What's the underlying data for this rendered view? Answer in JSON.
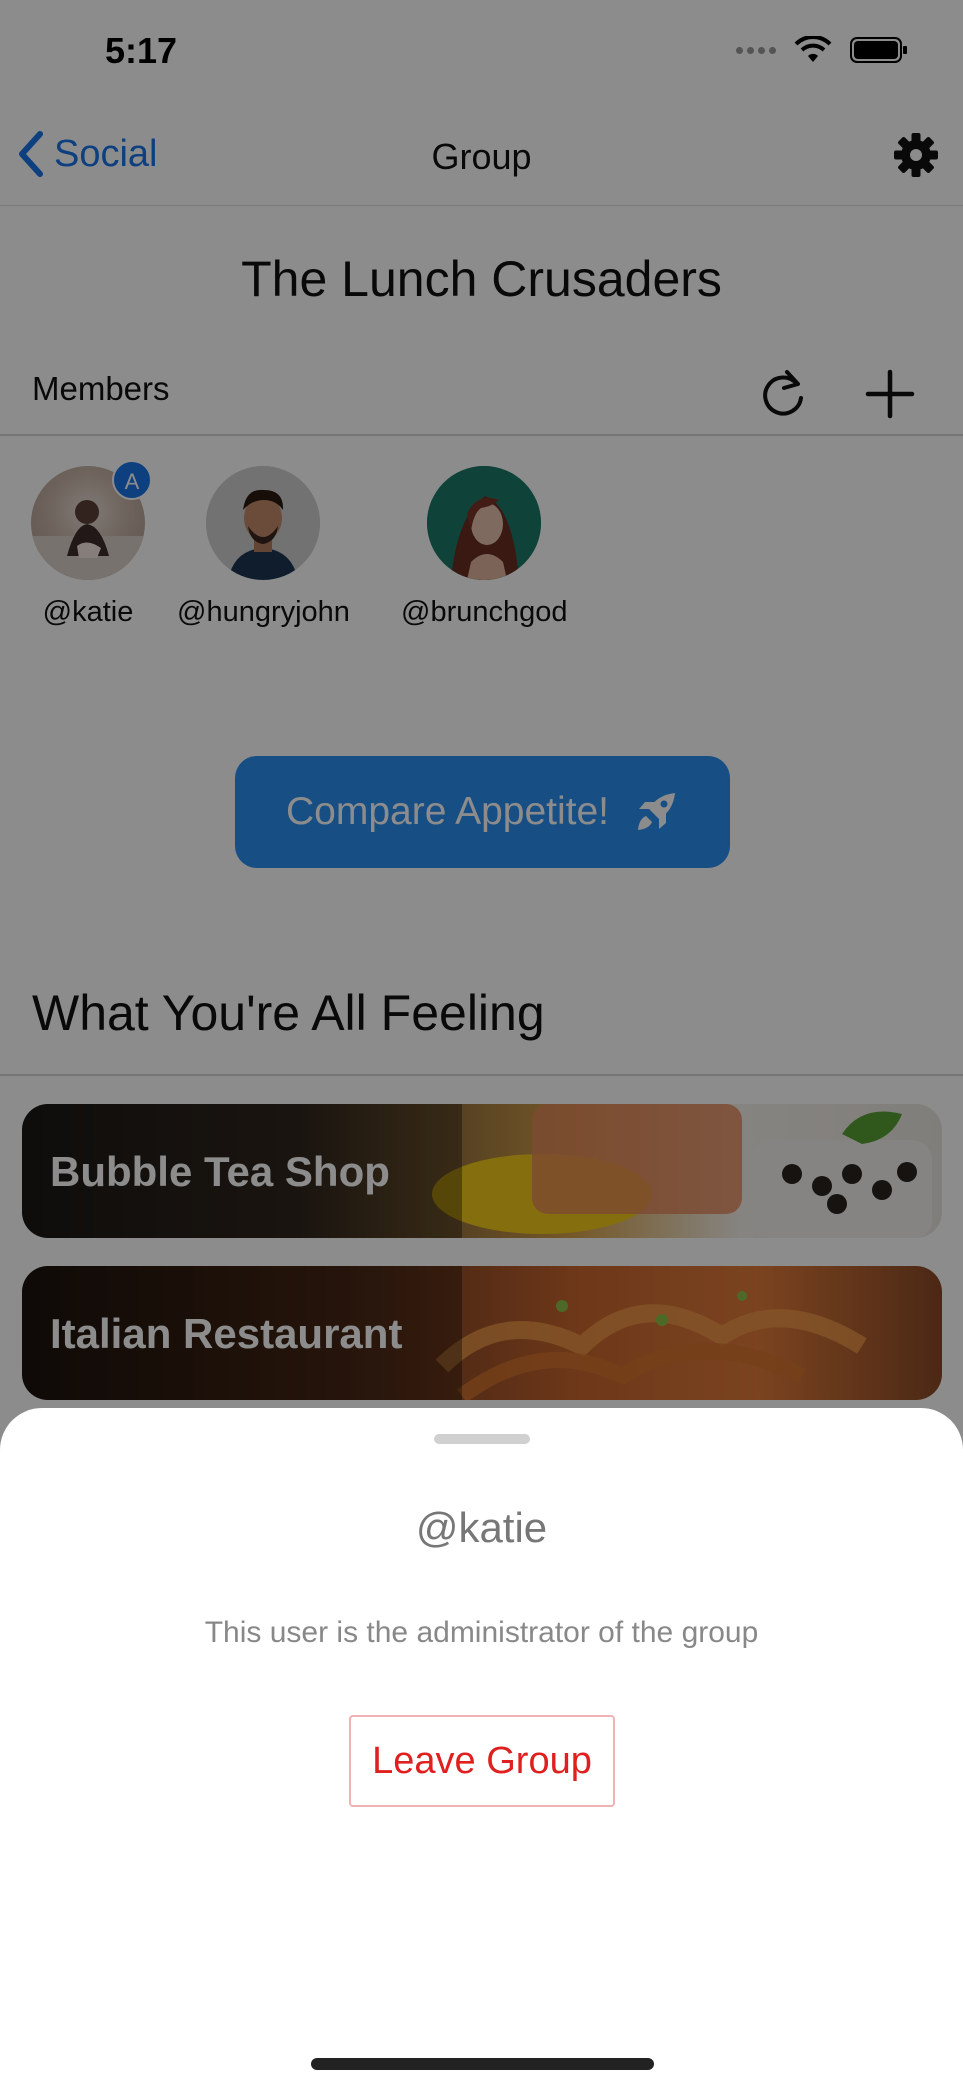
{
  "status": {
    "time": "5:17"
  },
  "nav": {
    "back_label": "Social",
    "title": "Group"
  },
  "group": {
    "name": "The Lunch Crusaders"
  },
  "members": {
    "label": "Members",
    "list": [
      {
        "handle": "@katie",
        "admin_badge": "A"
      },
      {
        "handle": "@hungryjohn"
      },
      {
        "handle": "@brunchgod"
      }
    ]
  },
  "compare": {
    "label": "Compare Appetite!"
  },
  "feeling": {
    "title": "What You're All Feeling",
    "cards": [
      {
        "label": "Bubble Tea Shop"
      },
      {
        "label": "Italian Restaurant"
      }
    ]
  },
  "sheet": {
    "user": "@katie",
    "description": "This user is the administrator of the group",
    "leave_label": "Leave Group"
  },
  "icons": {
    "back": "chevron-left-icon",
    "settings": "gear-icon",
    "refresh": "refresh-icon",
    "add": "plus-icon",
    "compare": "rocket-icon"
  },
  "colors": {
    "accent": "#2a8ef0",
    "link": "#1a73e8",
    "danger": "#e01f1f"
  }
}
